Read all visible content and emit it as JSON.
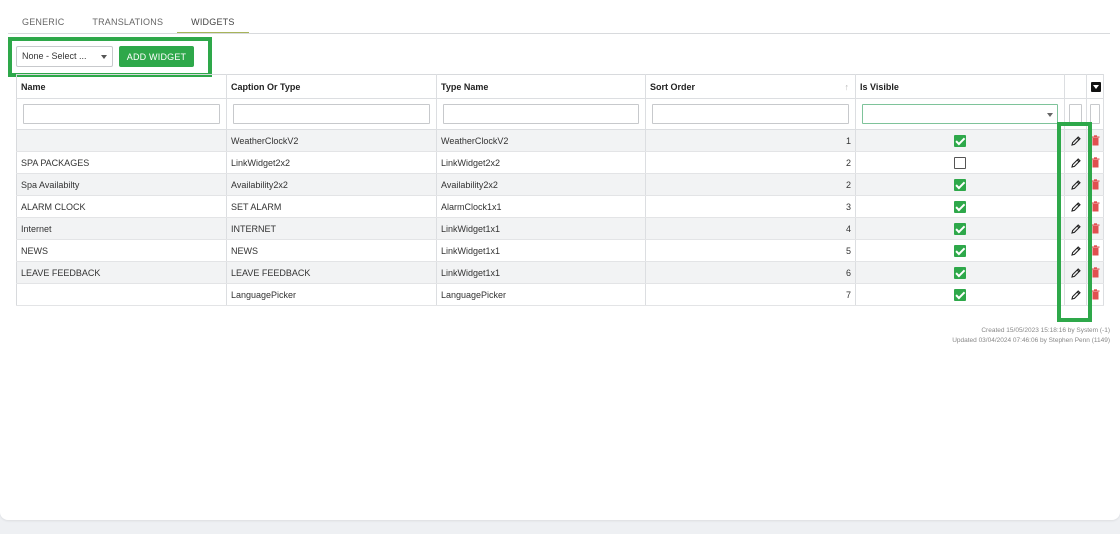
{
  "tabs": [
    {
      "label": "GENERIC",
      "active": false
    },
    {
      "label": "TRANSLATIONS",
      "active": false
    },
    {
      "label": "WIDGETS",
      "active": true
    }
  ],
  "toolbar": {
    "select_value": "None - Select ...",
    "add_label": "ADD WIDGET"
  },
  "table": {
    "columns": [
      "Name",
      "Caption Or Type",
      "Type Name",
      "Sort Order",
      "Is Visible"
    ],
    "rows": [
      {
        "name": "",
        "caption": "WeatherClockV2",
        "type_name": "WeatherClockV2",
        "sort": "1",
        "visible": true
      },
      {
        "name": "SPA PACKAGES",
        "caption": "LinkWidget2x2",
        "type_name": "LinkWidget2x2",
        "sort": "2",
        "visible": false
      },
      {
        "name": "Spa Availabilty",
        "caption": "Availability2x2",
        "type_name": "Availability2x2",
        "sort": "2",
        "visible": true
      },
      {
        "name": "ALARM CLOCK",
        "caption": "SET ALARM",
        "type_name": "AlarmClock1x1",
        "sort": "3",
        "visible": true
      },
      {
        "name": "Internet",
        "caption": "INTERNET",
        "type_name": "LinkWidget1x1",
        "sort": "4",
        "visible": true
      },
      {
        "name": "NEWS",
        "caption": "NEWS",
        "type_name": "LinkWidget1x1",
        "sort": "5",
        "visible": true
      },
      {
        "name": "LEAVE FEEDBACK",
        "caption": "LEAVE FEEDBACK",
        "type_name": "LinkWidget1x1",
        "sort": "6",
        "visible": true
      },
      {
        "name": "",
        "caption": "LanguagePicker",
        "type_name": "LanguagePicker",
        "sort": "7",
        "visible": true
      }
    ]
  },
  "audit": {
    "created": "Created 15/05/2023 15:18:16 by System (-1)",
    "updated": "Updated 03/04/2024 07:46:06 by Stephen Penn (1149)"
  },
  "colors": {
    "accent_green": "#2ea84a",
    "delete_red": "#e05050"
  },
  "icons": [
    "caret-down-icon",
    "sort-icon",
    "column-menu-icon",
    "checkbox-icon",
    "pencil-icon",
    "trash-icon"
  ]
}
